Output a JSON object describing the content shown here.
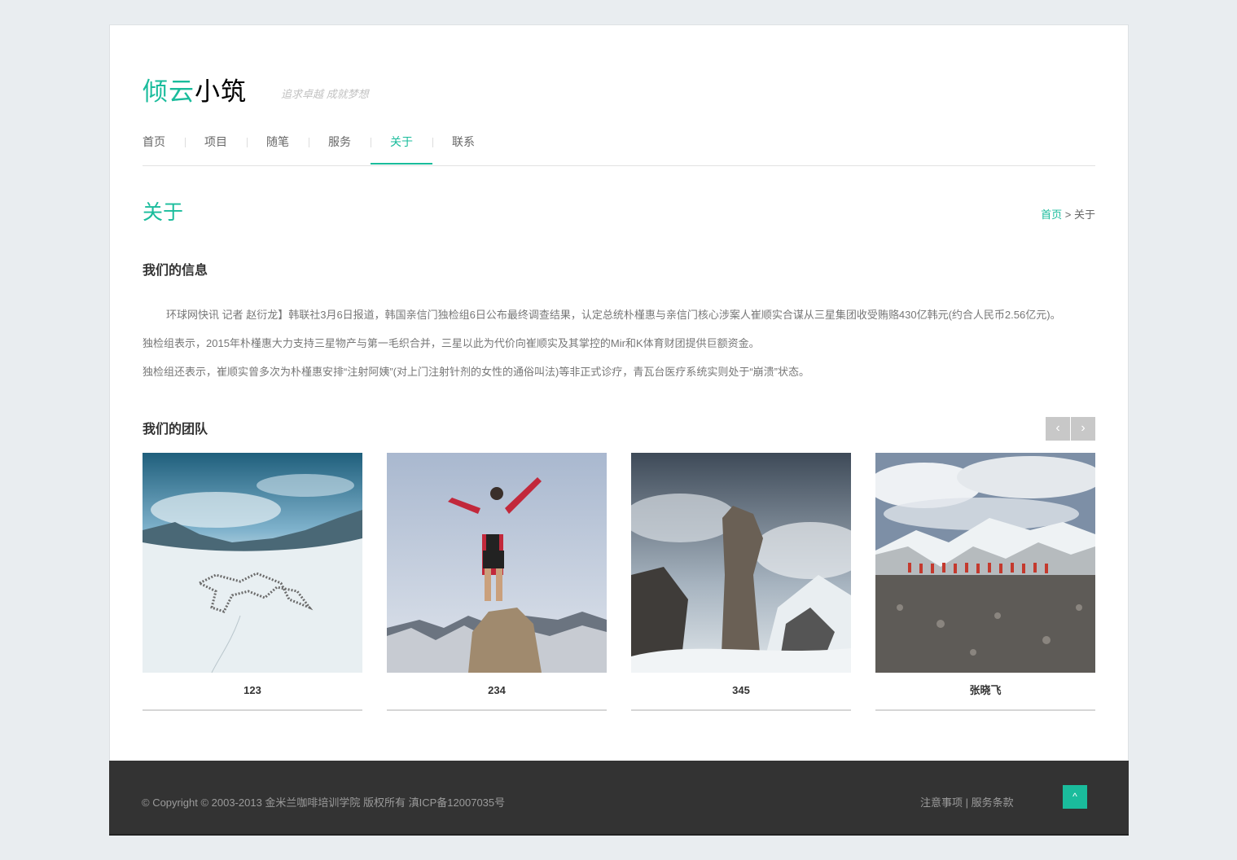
{
  "header": {
    "brand_part1": "倾云",
    "brand_part2": "小筑",
    "slogan": "追求卓越 成就梦想"
  },
  "nav": {
    "items": [
      {
        "label": "首页",
        "active": false
      },
      {
        "label": "项目",
        "active": false
      },
      {
        "label": "随笔",
        "active": false
      },
      {
        "label": "服务",
        "active": false
      },
      {
        "label": "关于",
        "active": true
      },
      {
        "label": "联系",
        "active": false
      }
    ]
  },
  "page": {
    "title": "关于",
    "breadcrumb_home": "首页",
    "breadcrumb_sep": " > ",
    "breadcrumb_current": "关于"
  },
  "info": {
    "heading": "我们的信息",
    "paragraphs": [
      "环球网快讯 记者 赵衍龙】韩联社3月6日报道，韩国亲信门独检组6日公布最终调查结果，认定总统朴槿惠与亲信门核心涉案人崔顺实合谋从三星集团收受贿赂430亿韩元(约合人民币2.56亿元)。",
      "独检组表示，2015年朴槿惠大力支持三星物产与第一毛织合并，三星以此为代价向崔顺实及其掌控的Mir和K体育财团提供巨额资金。",
      "独检组还表示，崔顺实曾多次为朴槿惠安排“注射阿姨”(对上门注射针剂的女性的通俗叫法)等非正式诊疗，青瓦台医疗系统实则处于“崩溃”状态。"
    ]
  },
  "team": {
    "heading": "我们的团队",
    "prev_label": "‹",
    "next_label": "›",
    "members": [
      {
        "name": "123",
        "photo": "snowfield-formation-photo"
      },
      {
        "name": "234",
        "photo": "summit-hiker-photo"
      },
      {
        "name": "345",
        "photo": "rock-pinnacle-photo"
      },
      {
        "name": "张晓飞",
        "photo": "mountain-line-photo"
      }
    ]
  },
  "footer": {
    "copyright": "© Copyright © 2003-2013 金米兰咖啡培训学院 版权所有 滇ICP备12007035号",
    "link1": "注意事项",
    "link_sep": " | ",
    "link2": "服务条款",
    "totop_label": "^"
  },
  "colors": {
    "accent": "#1abc9c",
    "footer_bg": "#333333",
    "page_bg": "#e9edf0"
  }
}
